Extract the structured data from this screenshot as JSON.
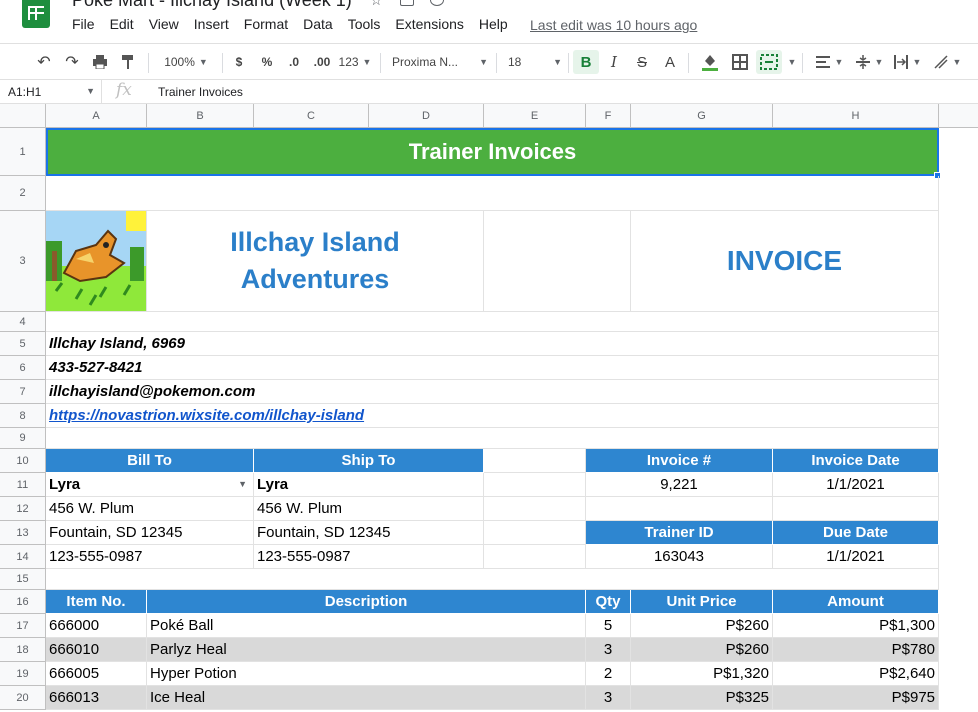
{
  "app": {
    "title": "Poké Mart - Illchay Island (Week 1)",
    "last_edit": "Last edit was 10 hours ago"
  },
  "menu": [
    "File",
    "Edit",
    "View",
    "Insert",
    "Format",
    "Data",
    "Tools",
    "Extensions",
    "Help"
  ],
  "toolbar": {
    "zoom": "100%",
    "currency": "$",
    "percent": "%",
    "dec_less": ".0",
    "dec_more": ".00",
    "more_formats": "123",
    "font": "Proxima N...",
    "font_size": "18",
    "bold": "B",
    "italic": "I",
    "strike": "S",
    "text_color": "A"
  },
  "formula": {
    "namebox": "A1:H1",
    "fx": "fx",
    "content": "Trainer Invoices"
  },
  "columns": [
    "A",
    "B",
    "C",
    "D",
    "E",
    "F",
    "G",
    "H"
  ],
  "rows": [
    "1",
    "2",
    "3",
    "4",
    "5",
    "6",
    "7",
    "8",
    "9",
    "10",
    "11",
    "12",
    "13",
    "14",
    "15",
    "16",
    "17",
    "18",
    "19",
    "20"
  ],
  "sheet": {
    "title": "Trainer Invoices",
    "company": {
      "name_line1": "Illchay Island",
      "name_line2": "Adventures",
      "invoice_label": "INVOICE"
    },
    "contact": {
      "address": "Illchay Island, 6969",
      "phone": "433-527-8421",
      "email": "illchayisland@pokemon.com",
      "website": "https://novastrion.wixsite.com/illchay-island"
    },
    "bill_to": {
      "header": "Bill To",
      "name": "Lyra",
      "street": "456 W. Plum",
      "city": "Fountain, SD 12345",
      "phone": "123-555-0987"
    },
    "ship_to": {
      "header": "Ship To",
      "name": "Lyra",
      "street": "456 W. Plum",
      "city": "Fountain, SD 12345",
      "phone": "123-555-0987"
    },
    "invoice_no": {
      "header": "Invoice #",
      "value": "9,221"
    },
    "invoice_date": {
      "header": "Invoice Date",
      "value": "1/1/2021"
    },
    "trainer_id": {
      "header": "Trainer ID",
      "value": "163043"
    },
    "due_date": {
      "header": "Due Date",
      "value": "1/1/2021"
    },
    "items_header": {
      "item": "Item No.",
      "desc": "Description",
      "qty": "Qty",
      "price": "Unit Price",
      "amount": "Amount"
    },
    "items": [
      {
        "item": "666000",
        "desc": "Poké Ball",
        "qty": "5",
        "price": "P$260",
        "amount": "P$1,300"
      },
      {
        "item": "666010",
        "desc": "Parlyz Heal",
        "qty": "3",
        "price": "P$260",
        "amount": "P$780"
      },
      {
        "item": "666005",
        "desc": "Hyper Potion",
        "qty": "2",
        "price": "P$1,320",
        "amount": "P$2,640"
      },
      {
        "item": "666013",
        "desc": "Ice Heal",
        "qty": "3",
        "price": "P$325",
        "amount": "P$975"
      }
    ]
  },
  "colors": {
    "title_green": "#4caf3f",
    "header_blue": "#2e86d0",
    "company_blue": "#2b7fc9",
    "link_blue": "#1155cc",
    "stripe": "#d9d9d9"
  }
}
